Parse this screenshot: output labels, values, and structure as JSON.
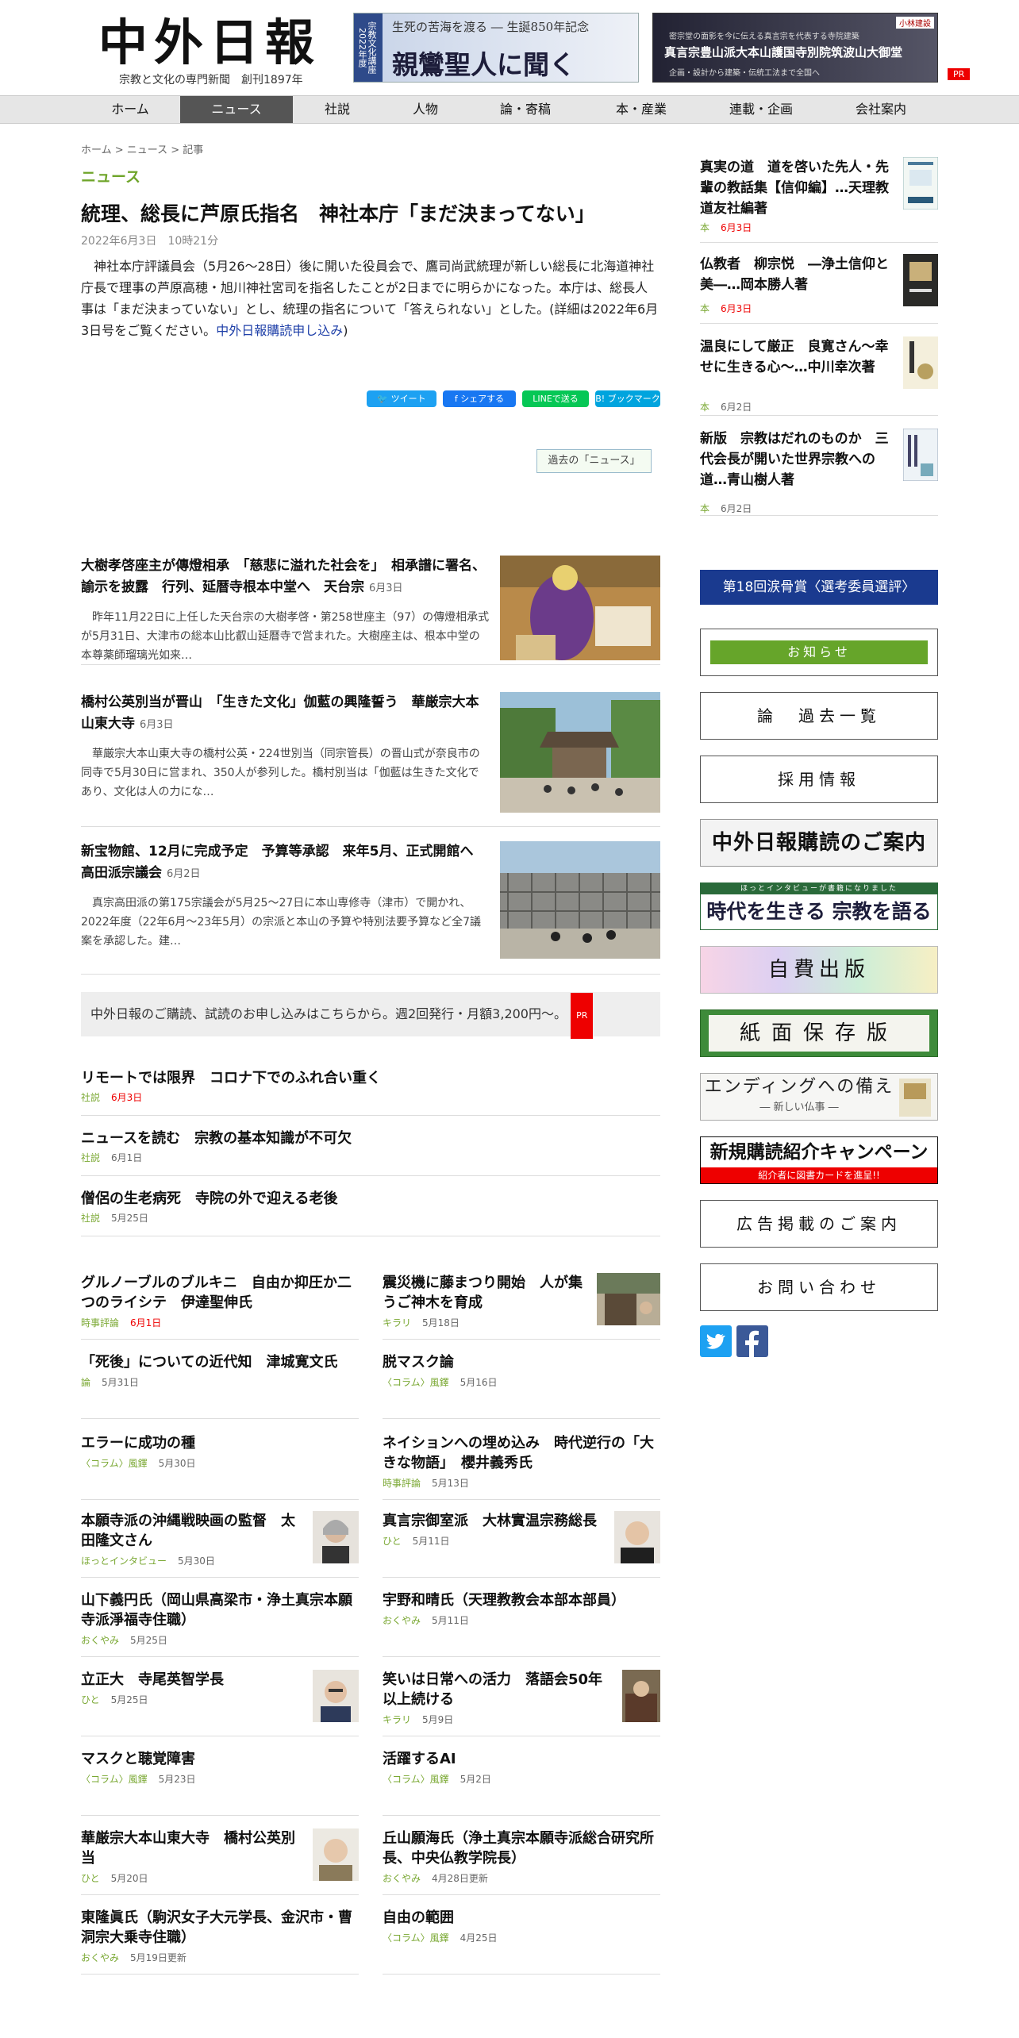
{
  "header": {
    "logo_text": "中外日報",
    "tagline": "宗教と文化の専門新聞　創刊1897年",
    "banner1_side": "宗教文化講座2022年度",
    "banner1_top": "生死の苦海を渡る ― 生誕850年記念",
    "banner1_main": "親鸞聖人に聞く",
    "banner2_small": "密宗堂の面影を今に伝える真言宗を代表する寺院建築",
    "banner2_main": "真言宗豊山派大本山護国寺別院筑波山大御堂",
    "banner2_foot": "企画・設計から建築・伝統工法まで全国へ",
    "banner2_corner": "小林建設",
    "pr": "PR"
  },
  "nav": {
    "items": [
      {
        "label": "ホーム"
      },
      {
        "label": "ニュース"
      },
      {
        "label": "社説"
      },
      {
        "label": "人物"
      },
      {
        "label": "論・寄稿"
      },
      {
        "label": "本・産業"
      },
      {
        "label": "連載・企画"
      },
      {
        "label": "会社案内"
      }
    ],
    "active_index": 1
  },
  "breadcrumb": "ホーム > ニュース > 記事",
  "section_label": "ニュース",
  "article": {
    "title": "統理、総長に芦原氏指名　神社本庁「まだ決まってない」",
    "date": "2022年6月3日　10時21分",
    "body": "神社本庁評議員会（5月26〜28日）後に開いた役員会で、鷹司尚武統理が新しい総長に北海道神社庁長で理事の芦原高穂・旭川神社宮司を指名したことが2日までに明らかになった。本庁は、総長人事は「まだ決まっていない」とし、統理の指名について「答えられない」とした。(詳細は2022年6月3日号をご覧ください。",
    "link": "中外日報購読申し込み",
    "closing": ")"
  },
  "share": {
    "tweet": "ツイート",
    "facebook": "シェアする",
    "line": "LINEで送る",
    "hatena": "ブックマーク"
  },
  "past_news": "過去の「ニュース」",
  "featured": [
    {
      "title": "大樹孝啓座主が傳燈相承　「慈悲に溢れた社会を」　相承譜に署名、諭示を披露　行列、延暦寺根本中堂へ　天台宗",
      "date": "6月3日",
      "excerpt": "昨年11月22日に上任した天台宗の大樹孝啓・第258世座主（97）の傳燈相承式が5月31日、大津市の総本山比叡山延暦寺で営まれた。大樹座主は、根本中堂の本尊薬師瑠璃光如来…"
    },
    {
      "title": "橋村公英別当が晋山　「生きた文化」伽藍の興隆誓う　華厳宗大本山東大寺",
      "date": "6月3日",
      "excerpt": "華厳宗大本山東大寺の橋村公英・224世別当（同宗管長）の晋山式が奈良市の同寺で5月30日に営まれ、350人が参列した。橋村別当は「伽藍は生きた文化であり、文化は人の力にな…"
    },
    {
      "title": "新宝物館、12月に完成予定　予算等承認　来年5月、正式開館へ　高田派宗議会",
      "date": "6月2日",
      "excerpt": "真宗高田派の第175宗議会が5月25〜27日に本山専修寺（津市）で開かれ、2022年度（22年6月〜23年5月）の宗派と本山の予算や特別法要予算など全7議案を承認した。建…"
    }
  ],
  "subscribe_bar": {
    "text": "中外日報のご購読、試読のお申し込みはこちらから。週2回発行・月額3,200円〜。",
    "pr": "PR"
  },
  "editorials": [
    {
      "title": "リモートでは限界　コロナ下でのふれ合い重く",
      "category": "社説",
      "date": "6月3日",
      "red": true
    },
    {
      "title": "ニュースを読む　宗教の基本知識が不可欠",
      "category": "社説",
      "date": "6月1日",
      "red": false
    },
    {
      "title": "僧侶の生老病死　寺院の外で迎える老後",
      "category": "社説",
      "date": "5月25日",
      "red": false
    }
  ],
  "grid_left": [
    {
      "title": "グルノーブルのブルキニ　自由か抑圧か二つのライシテ　伊達聖伸氏",
      "category": "時事評論",
      "date": "6月1日",
      "red": true
    },
    {
      "title": "「死後」についての近代知　津城寛文氏",
      "category": "論",
      "date": "5月31日",
      "red": false
    },
    {
      "title": "エラーに成功の種",
      "category": "〈コラム〉風鐸",
      "date": "5月30日",
      "red": false
    },
    {
      "title": "本願寺派の沖縄戦映画の監督　太田隆文さん",
      "category": "ほっとインタビュー",
      "date": "5月30日",
      "red": false,
      "photo": true
    },
    {
      "title": "山下義円氏（岡山県高梁市・浄土真宗本願寺派淨福寺住職）",
      "category": "おくやみ",
      "date": "5月25日",
      "red": false
    },
    {
      "title": "立正大　寺尾英智学長",
      "category": "ひと",
      "date": "5月25日",
      "red": false,
      "photo": true
    },
    {
      "title": "マスクと聴覚障害",
      "category": "〈コラム〉風鐸",
      "date": "5月23日",
      "red": false
    },
    {
      "title": "華厳宗大本山東大寺　橋村公英別当",
      "category": "ひと",
      "date": "5月20日",
      "red": false,
      "photo": true
    },
    {
      "title": "東隆眞氏（駒沢女子大元学長、金沢市・曹洞宗大乗寺住職）",
      "category": "おくやみ",
      "date": "5月19日更新",
      "red": false
    }
  ],
  "grid_right": [
    {
      "title": "震災機に藤まつり開始　人が集うご神木を育成",
      "category": "キラリ",
      "date": "5月18日",
      "red": false,
      "photo": true
    },
    {
      "title": "脱マスク論",
      "category": "〈コラム〉風鐸",
      "date": "5月16日",
      "red": false
    },
    {
      "title": "ネイションへの埋め込み　時代逆行の「大きな物語」　櫻井義秀氏",
      "category": "時事評論",
      "date": "5月13日",
      "red": false
    },
    {
      "title": "真言宗御室派　大林實温宗務総長",
      "category": "ひと",
      "date": "5月11日",
      "red": false,
      "photo": true
    },
    {
      "title": "宇野和晴氏（天理教教会本部本部員）",
      "category": "おくやみ",
      "date": "5月11日",
      "red": false
    },
    {
      "title": "笑いは日常への活力　落語会50年以上続ける",
      "category": "キラリ",
      "date": "5月9日",
      "red": false,
      "photo": true
    },
    {
      "title": "活躍するAI",
      "category": "〈コラム〉風鐸",
      "date": "5月2日",
      "red": false
    },
    {
      "title": "丘山願海氏（浄土真宗本願寺派総合研究所長、中央仏教学院長）",
      "category": "おくやみ",
      "date": "4月28日更新",
      "red": false
    },
    {
      "title": "自由の範囲",
      "category": "〈コラム〉風鐸",
      "date": "4月25日",
      "red": false
    }
  ],
  "sidebar": {
    "books": [
      {
        "title": "真実の道　道を啓いた先人・先輩の教話集【信仰編】…天理教道友社編著",
        "category": "本",
        "date": "6月3日",
        "red": true
      },
      {
        "title": "仏教者　柳宗悦　―浄土信仰と美―…岡本勝人著",
        "category": "本",
        "date": "6月3日",
        "red": true
      },
      {
        "title": "温良にして厳正　良寛さん〜幸せに生きる心〜…中川幸次著",
        "category": "本",
        "date": "6月2日",
        "red": false
      },
      {
        "title": "新版　宗教はだれのものか　三代会長が開いた世界宗教への道…青山樹人著",
        "category": "本",
        "date": "6月2日",
        "red": false
      }
    ],
    "prize_banner": "第18回涙骨賞〈選考委員選評〉",
    "notice_label": "お知らせ",
    "boxes": [
      {
        "label": "論　過去一覧"
      },
      {
        "label": "採用情報"
      }
    ],
    "subscribe_banner": "中外日報購読のご案内",
    "religion_banner_small": "ほっとインタビューが書籍になりました",
    "religion_banner_main": "時代を生きる 宗教を語る",
    "self_publish": "自費出版",
    "paper_archive": "紙面保存版",
    "ending_main": "エンディングへの備え",
    "ending_sub": "― 新しい仏事 ―",
    "campaign_main": "新規購読紹介キャンペーン",
    "campaign_sub": "紹介者に図書カードを進呈!!",
    "ad_info": "広告掲載のご案内",
    "contact": "お問い合わせ",
    "social_twitter": "twitter-icon",
    "social_facebook": "facebook-icon"
  },
  "colors": {
    "accent_green": "#6fa52a",
    "date_red": "#e00000",
    "nav_active": "#555555",
    "prize_blue": "#1a3a8f"
  }
}
